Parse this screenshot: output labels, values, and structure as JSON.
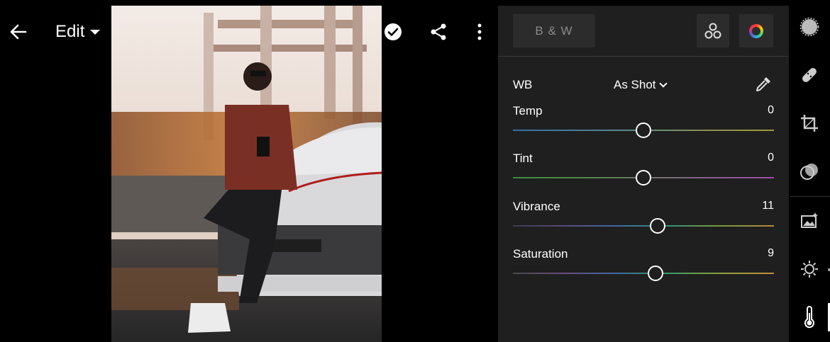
{
  "topbar": {
    "mode_label": "Edit"
  },
  "panel": {
    "bw_label": "B & W",
    "wb": {
      "label": "WB",
      "value": "As Shot"
    },
    "sliders": [
      {
        "label": "Temp",
        "value": "0",
        "position": 0.5
      },
      {
        "label": "Tint",
        "value": "0",
        "position": 0.5
      },
      {
        "label": "Vibrance",
        "value": "11",
        "position": 0.555
      },
      {
        "label": "Saturation",
        "value": "9",
        "position": 0.545
      }
    ]
  },
  "icons": {
    "back": "arrow-left-icon",
    "undo": "undo-icon",
    "help": "question-circle-icon",
    "done": "check-circle-icon",
    "share": "share-icon",
    "more": "more-vertical-icon",
    "mixer": "color-mixer-icon",
    "color_grading": "color-wheel-icon",
    "eyedropper": "eyedropper-icon",
    "tools": [
      "selective-icon",
      "healing-icon",
      "crop-icon",
      "profile-icon",
      "auto-icon",
      "light-icon",
      "color-temperature-icon"
    ]
  }
}
